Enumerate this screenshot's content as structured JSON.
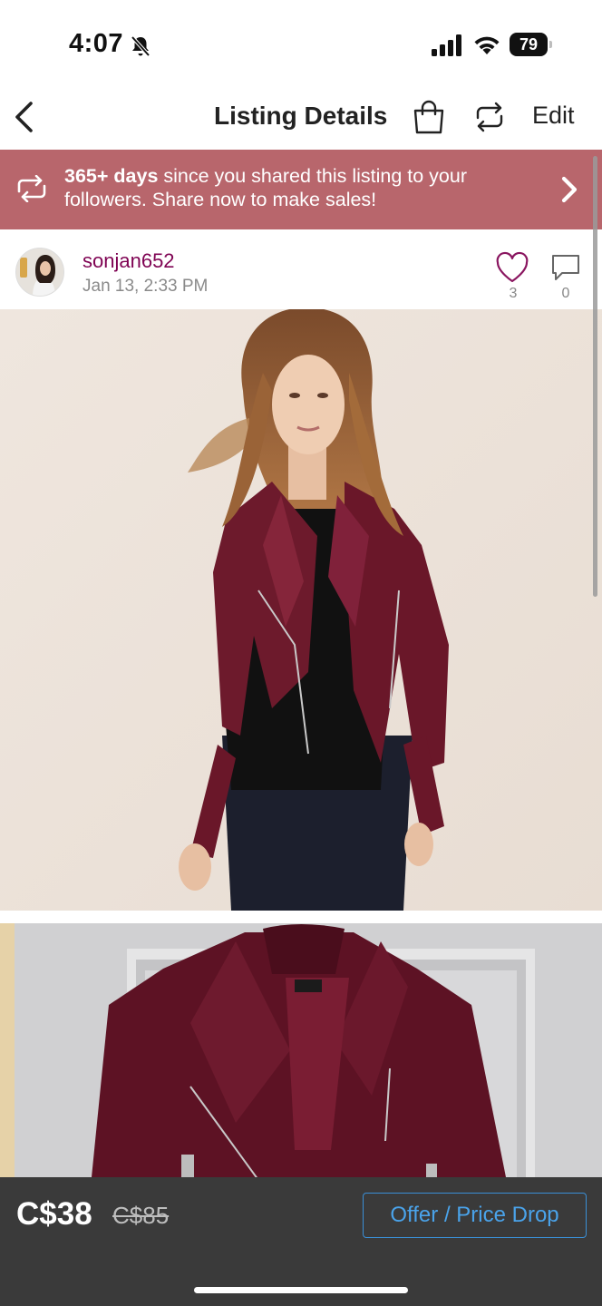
{
  "status_bar": {
    "time": "4:07",
    "battery": "79",
    "icons": [
      "bell-slash-icon",
      "cellular-signal-icon",
      "wifi-icon",
      "battery-icon"
    ]
  },
  "header": {
    "title": "Listing Details",
    "edit_label": "Edit",
    "icons": [
      "back-chevron-icon",
      "shopping-bag-icon",
      "share-repeat-icon"
    ]
  },
  "banner": {
    "bold_text": "365+ days",
    "text": " since you shared this listing to your followers. Share now to make sales!",
    "background_color": "#b8666c",
    "icons": [
      "share-repeat-icon",
      "chevron-right-icon"
    ]
  },
  "author": {
    "username": "sonjan652",
    "date": "Jan 13, 2:33 PM",
    "likes": "3",
    "comments": "0",
    "username_color": "#7f0353"
  },
  "photos": [
    {
      "label": "model wearing burgundy suede moto jacket"
    },
    {
      "label": "burgundy suede moto jacket on hanger"
    }
  ],
  "footer": {
    "price": "C$38",
    "original_price": "C$85",
    "offer_label": "Offer / Price Drop",
    "accent_color": "#4aa3ea",
    "background_color": "#3a3a3a"
  }
}
